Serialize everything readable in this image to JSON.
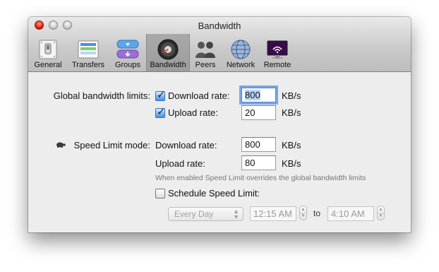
{
  "window": {
    "title": "Bandwidth"
  },
  "toolbar": {
    "items": [
      {
        "label": "General",
        "icon": "switch-icon"
      },
      {
        "label": "Transfers",
        "icon": "transfers-icon"
      },
      {
        "label": "Groups",
        "icon": "groups-icon"
      },
      {
        "label": "Bandwidth",
        "icon": "speedometer-icon"
      },
      {
        "label": "Peers",
        "icon": "people-icon"
      },
      {
        "label": "Network",
        "icon": "globe-icon"
      },
      {
        "label": "Remote",
        "icon": "remote-display-icon"
      }
    ],
    "selected": "Bandwidth"
  },
  "global_limits": {
    "heading": "Global bandwidth limits:",
    "download": {
      "label": "Download rate:",
      "checked": true,
      "value": "800",
      "unit": "KB/s"
    },
    "upload": {
      "label": "Upload rate:",
      "checked": true,
      "value": "20",
      "unit": "KB/s"
    }
  },
  "speed_limit": {
    "heading": "Speed Limit mode:",
    "icon": "turtle-icon",
    "download": {
      "label": "Download rate:",
      "value": "800",
      "unit": "KB/s"
    },
    "upload": {
      "label": "Upload rate:",
      "value": "80",
      "unit": "KB/s"
    },
    "note": "When enabled Speed Limit overrides the global bandwidth limits"
  },
  "schedule": {
    "label": "Schedule Speed Limit:",
    "checked": false,
    "day": "Every Day",
    "from": "12:15 AM",
    "to_label": "to",
    "to": "4:10 AM"
  },
  "colors": {
    "focus_ring": "#7aa7e6",
    "checkbox_checked": "#4d8fe0",
    "close_button": "#d81f0f"
  }
}
